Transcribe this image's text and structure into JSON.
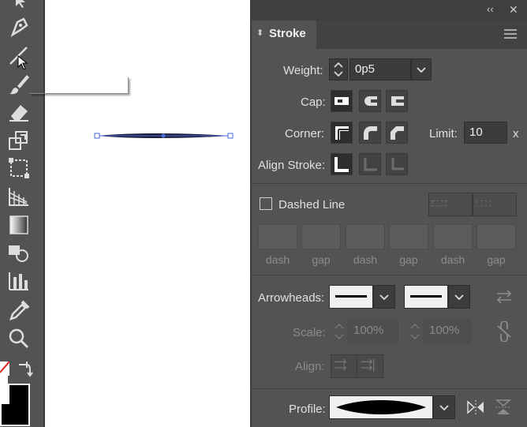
{
  "panel": {
    "title": "Stroke",
    "collapse_glyph": "‹‹",
    "close_glyph": "✕",
    "menu_icon": "hamburger-menu-icon"
  },
  "weight": {
    "label": "Weight:",
    "value": "0p5"
  },
  "cap": {
    "label": "Cap:"
  },
  "corner": {
    "label": "Corner:",
    "limit_label": "Limit:",
    "limit_value": "10",
    "limit_unit": "x"
  },
  "align": {
    "label": "Align Stroke:"
  },
  "dashed": {
    "label": "Dashed Line",
    "checked": false,
    "cells": [
      "dash",
      "gap",
      "dash",
      "gap",
      "dash",
      "gap"
    ]
  },
  "arrowheads": {
    "label": "Arrowheads:"
  },
  "scale": {
    "label": "Scale:",
    "start": "100%",
    "end": "100%"
  },
  "align_arrows": {
    "label": "Align:"
  },
  "profile": {
    "label": "Profile:"
  },
  "colors": {
    "panel_bg": "#535353",
    "dark": "#2e2e2e",
    "text": "#e0e0e0",
    "dim": "#8a8a8a",
    "anchor": "#4a6bd8"
  }
}
